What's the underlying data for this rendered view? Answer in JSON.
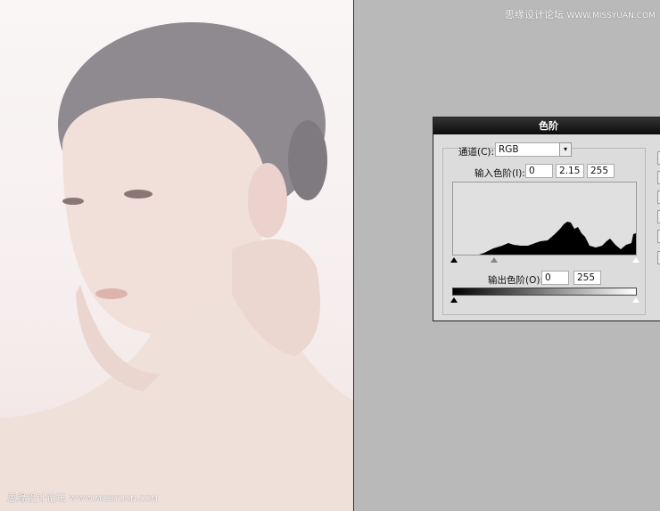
{
  "watermark": {
    "cn": "思缘设计论坛",
    "url": "WWW.MISSYUAN.COM"
  },
  "dialog": {
    "title": "色阶",
    "channel_label": "通道(C):",
    "channel_value": "RGB",
    "input_label": "输入色阶(I):",
    "input_black": "0",
    "input_gamma": "2.15",
    "input_white": "255",
    "output_label": "输出色阶(O):",
    "output_black": "0",
    "output_white": "255"
  }
}
